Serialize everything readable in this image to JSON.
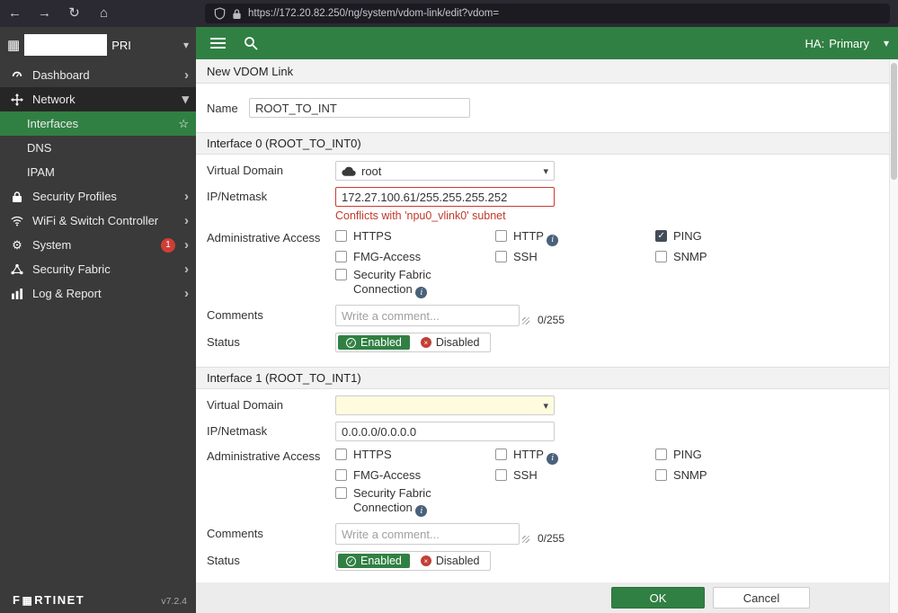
{
  "colors": {
    "accent_green": "#318043",
    "error_red": "#c0392b",
    "badge_red": "#cf3e36",
    "checked_checkbox": "#434c59"
  },
  "icons": {
    "back": "←",
    "forward": "→",
    "refresh": "↻",
    "home": "⌂",
    "caret_down": "▾",
    "chevron_right": "›",
    "star": "☆",
    "gear": "⚙",
    "check": "✓",
    "cross": "×",
    "grid": "▦",
    "info": "i"
  },
  "browser": {
    "url": "https://172.20.82.250/ng/system/vdom-link/edit?vdom="
  },
  "sidebar": {
    "brand": "PRI",
    "items": [
      {
        "label": "Dashboard"
      },
      {
        "label": "Network"
      },
      {
        "label": "Interfaces"
      },
      {
        "label": "DNS"
      },
      {
        "label": "IPAM"
      },
      {
        "label": "Security Profiles"
      },
      {
        "label": "WiFi & Switch Controller"
      },
      {
        "label": "System"
      },
      {
        "label": "Security Fabric"
      },
      {
        "label": "Log & Report"
      }
    ],
    "system_badge": "1",
    "logo_f": "F",
    "logo_rest": "RTINET",
    "version": "v7.2.4"
  },
  "topbar": {
    "ha_label": "HA:",
    "ha_value": "Primary"
  },
  "page": {
    "title": "New VDOM Link"
  },
  "form": {
    "name_label": "Name",
    "name_value": "ROOT_TO_INT",
    "labels": {
      "virtual_domain": "Virtual Domain",
      "ip_netmask": "IP/Netmask",
      "admin_access": "Administrative Access",
      "comments": "Comments",
      "status": "Status"
    },
    "access": {
      "https": "HTTPS",
      "http": "HTTP",
      "ping": "PING",
      "fmg": "FMG-Access",
      "ssh": "SSH",
      "snmp": "SNMP",
      "fabric": "Security Fabric Connection"
    },
    "status_enabled": "Enabled",
    "status_disabled": "Disabled",
    "comments_placeholder": "Write a comment...",
    "interface0": {
      "section_title": "Interface 0 (ROOT_TO_INT0)",
      "vdom_value": "root",
      "ip_value": "172.27.100.61/255.255.255.252",
      "ip_error": "Conflicts with 'npu0_vlink0' subnet",
      "checks": {
        "https": false,
        "http": false,
        "ping": true,
        "fmg": false,
        "ssh": false,
        "snmp": false,
        "fabric": false
      },
      "comment_counter": "0/255",
      "status_is_enabled": true
    },
    "interface1": {
      "section_title": "Interface 1 (ROOT_TO_INT1)",
      "vdom_value": "",
      "ip_value": "0.0.0.0/0.0.0.0",
      "checks": {
        "https": false,
        "http": false,
        "ping": false,
        "fmg": false,
        "ssh": false,
        "snmp": false,
        "fabric": false
      },
      "comment_counter": "0/255",
      "status_is_enabled": true
    }
  },
  "footer": {
    "ok": "OK",
    "cancel": "Cancel"
  }
}
